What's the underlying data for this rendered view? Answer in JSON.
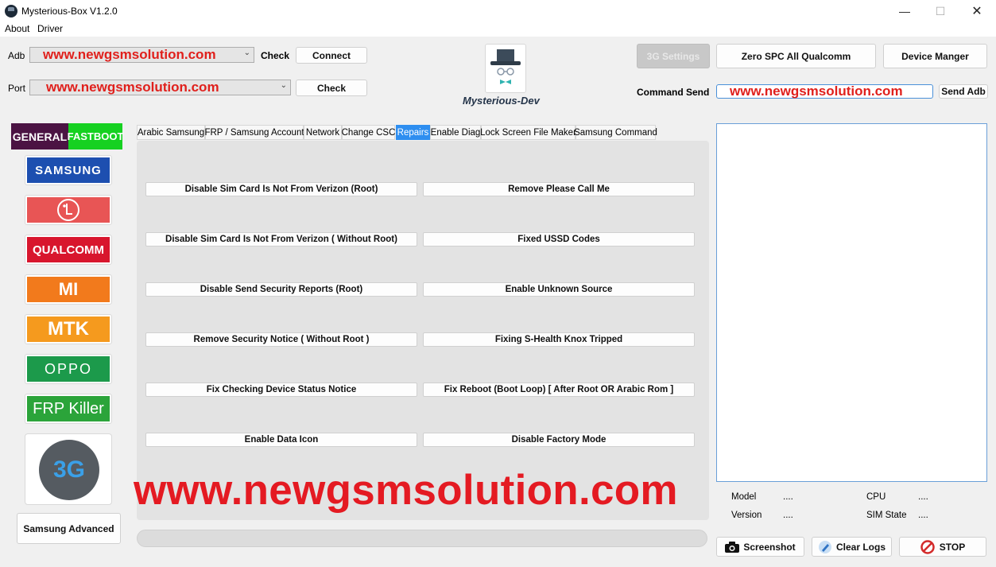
{
  "window": {
    "title": "Mysterious-Box V1.2.0",
    "min": "—",
    "max": "☐",
    "close": "✕"
  },
  "menu": [
    "About",
    "Driver"
  ],
  "adb": {
    "label": "Adb",
    "value": "www.newgsmsolution.com",
    "check": "Check",
    "connect": "Connect"
  },
  "port": {
    "label": "Port",
    "value": "www.newgsmsolution.com",
    "check": "Check"
  },
  "logo": {
    "text": "Mysterious-Dev"
  },
  "right_top": {
    "settings_3g": "3G Settings",
    "zero_spc": "Zero SPC All Qualcomm",
    "device_manager": "Device Manger",
    "command_label": "Command Send",
    "command_value": "www.newgsmsolution.com",
    "send_adb": "Send Adb"
  },
  "side": {
    "general": "GENERAL",
    "fastboot": "FASTBOOT",
    "brands": [
      {
        "name": "SAMSUNG",
        "color": "#1d4fb0"
      },
      {
        "name": "LG",
        "color": "#e85555"
      },
      {
        "name": "QUALCOMM",
        "color": "#d8162d"
      },
      {
        "name": "MI",
        "color": "#f27a1c"
      },
      {
        "name": "MTK",
        "color": "#f59a1e"
      },
      {
        "name": "OPPO",
        "color": "#1c9a4b"
      },
      {
        "name": "FRP Killer",
        "color": "#2ba43a"
      }
    ],
    "three_g": "3G",
    "samsung_advanced": "Samsung Advanced"
  },
  "tabs": [
    "Arabic Samsung",
    "FRP / Samsung Account",
    "Network",
    "Change CSC",
    "Repairs",
    "Enable Diag",
    "Lock Screen File Maker",
    "Samsung Command"
  ],
  "active_tab": "Repairs",
  "repairs": {
    "left": [
      "Disable Sim Card Is Not From Verizon (Root)",
      "Disable Sim Card Is Not From Verizon ( Without Root)",
      "Disable Send Security Reports (Root)",
      "Remove Security Notice ( Without Root )",
      "Fix Checking Device Status Notice",
      "Enable Data Icon"
    ],
    "right": [
      "Remove Please Call Me",
      "Fixed USSD Codes",
      "Enable Unknown Source",
      "Fixing S-Health Knox Tripped",
      "Fix Reboot (Boot Loop) [ After Root OR Arabic Rom ]",
      "Disable Factory Mode"
    ]
  },
  "watermark": "www.newgsmsolution.com",
  "progress": 0,
  "info": {
    "model_label": "Model",
    "model_value": "....",
    "cpu_label": "CPU",
    "cpu_value": "....",
    "version_label": "Version",
    "version_value": "....",
    "sim_label": "SIM State",
    "sim_value": "...."
  },
  "actions": {
    "screenshot": "Screenshot",
    "clear_logs": "Clear Logs",
    "stop": "STOP"
  }
}
